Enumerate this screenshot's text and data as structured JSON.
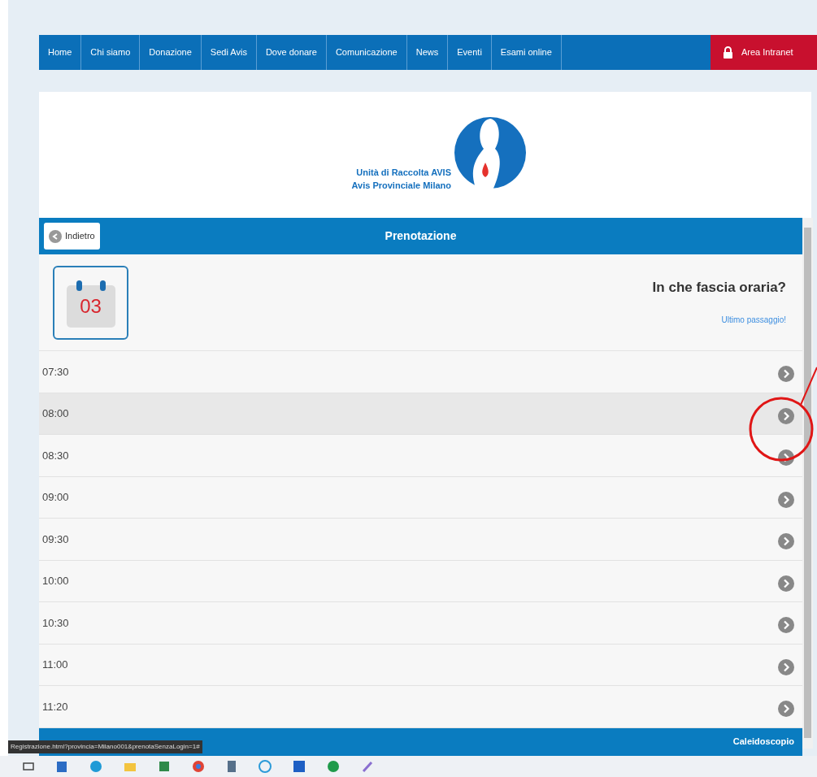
{
  "nav": {
    "items": [
      {
        "label": "Home"
      },
      {
        "label": "Chi siamo"
      },
      {
        "label": "Donazione"
      },
      {
        "label": "Sedi Avis"
      },
      {
        "label": "Dove donare"
      },
      {
        "label": "Comunicazione"
      },
      {
        "label": "News"
      },
      {
        "label": "Eventi"
      },
      {
        "label": "Esami online"
      }
    ],
    "intranet": "Area Intranet"
  },
  "logo": {
    "line_1": "Unità di Raccolta AVIS",
    "line_2": "Avis Provinciale Milano"
  },
  "header": {
    "back": "Indietro",
    "title": "Prenotazione"
  },
  "intro": {
    "day": "03",
    "question": "In che fascia oraria?",
    "note": "Ultimo passaggio!"
  },
  "slots": [
    {
      "time": "07:30",
      "highlighted": false
    },
    {
      "time": "08:00",
      "highlighted": true
    },
    {
      "time": "08:30",
      "highlighted": false
    },
    {
      "time": "09:00",
      "highlighted": false
    },
    {
      "time": "09:30",
      "highlighted": false
    },
    {
      "time": "10:00",
      "highlighted": false
    },
    {
      "time": "10:30",
      "highlighted": false
    },
    {
      "time": "11:00",
      "highlighted": false
    },
    {
      "time": "11:20",
      "highlighted": false
    }
  ],
  "footer": {
    "text": "Caleidoscopio"
  },
  "status_bar": {
    "url": "Registrazione.html?provincia=Milano001&prenotaSenzaLogin=1#"
  }
}
